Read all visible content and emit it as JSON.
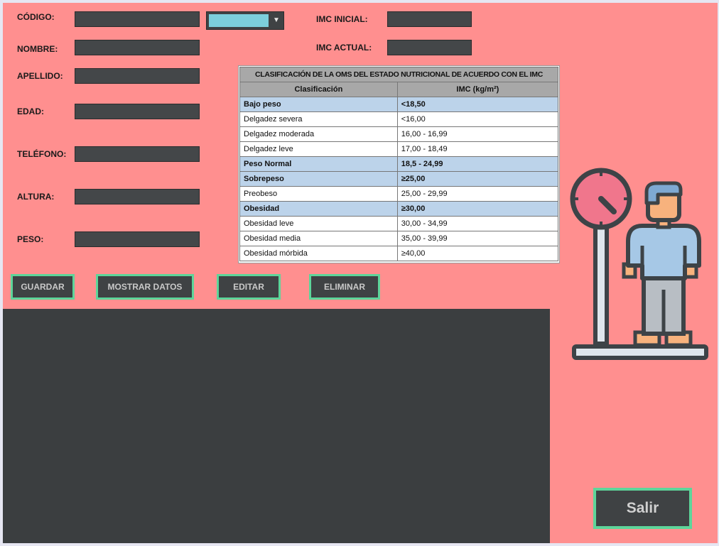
{
  "form": {
    "codigo_label": "CÓDIGO:",
    "nombre_label": "NOMBRE:",
    "apellido_label": "APELLIDO:",
    "edad_label": "EDAD:",
    "telefono_label": "TELÉFONO:",
    "altura_label": "ALTURA:",
    "peso_label": "PESO:",
    "imc_inicial_label": "IMC INICIAL:",
    "imc_actual_label": "IMC ACTUAL:"
  },
  "buttons": {
    "guardar": "GUARDAR",
    "mostrar": "MOSTRAR DATOS",
    "editar": "EDITAR",
    "eliminar": "ELIMINAR",
    "salir": "Salir"
  },
  "imc_table": {
    "title": "CLASIFICACIÓN DE LA OMS DEL ESTADO NUTRICIONAL DE ACUERDO CON EL IMC",
    "header": [
      "Clasificación",
      "IMC (kg/m²)"
    ],
    "rows": [
      {
        "c": "Bajo peso",
        "v": "<18,50",
        "bold": true
      },
      {
        "c": "Delgadez severa",
        "v": "<16,00",
        "bold": false
      },
      {
        "c": "Delgadez moderada",
        "v": "16,00 - 16,99",
        "bold": false
      },
      {
        "c": "Delgadez leve",
        "v": "17,00 - 18,49",
        "bold": false
      },
      {
        "c": "Peso Normal",
        "v": "18,5 - 24,99",
        "bold": true
      },
      {
        "c": "Sobrepeso",
        "v": "≥25,00",
        "bold": true
      },
      {
        "c": "Preobeso",
        "v": "25,00 - 29,99",
        "bold": false
      },
      {
        "c": "Obesidad",
        "v": "≥30,00",
        "bold": true
      },
      {
        "c": "Obesidad leve",
        "v": "30,00 - 34,99",
        "bold": false
      },
      {
        "c": "Obesidad media",
        "v": "35,00 - 39,99",
        "bold": false
      },
      {
        "c": "Obesidad mórbida",
        "v": "≥40,00",
        "bold": false
      }
    ]
  },
  "colors": {
    "panel_bg": "#ff8f8f",
    "field_bg": "#444749",
    "button_border": "#5dd59a",
    "combo_value_bg": "#7ccfdc"
  },
  "icons": {
    "illustration": "person-on-scale-icon",
    "dropdown": "triangle-down-icon"
  }
}
